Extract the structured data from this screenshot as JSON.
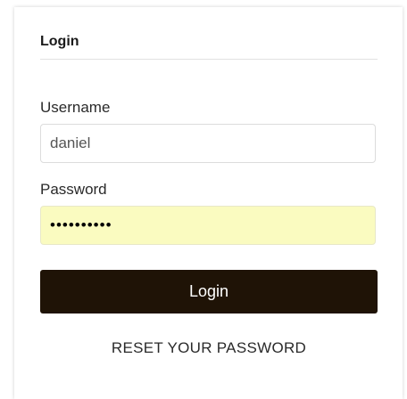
{
  "login_form": {
    "title": "Login",
    "username_label": "Username",
    "username_value": "daniel",
    "password_label": "Password",
    "password_value": "••••••••••",
    "submit_label": "Login",
    "reset_link": "RESET YOUR PASSWORD"
  },
  "colors": {
    "button_bg": "#1f1306",
    "autofill_bg": "#fafbc0"
  }
}
